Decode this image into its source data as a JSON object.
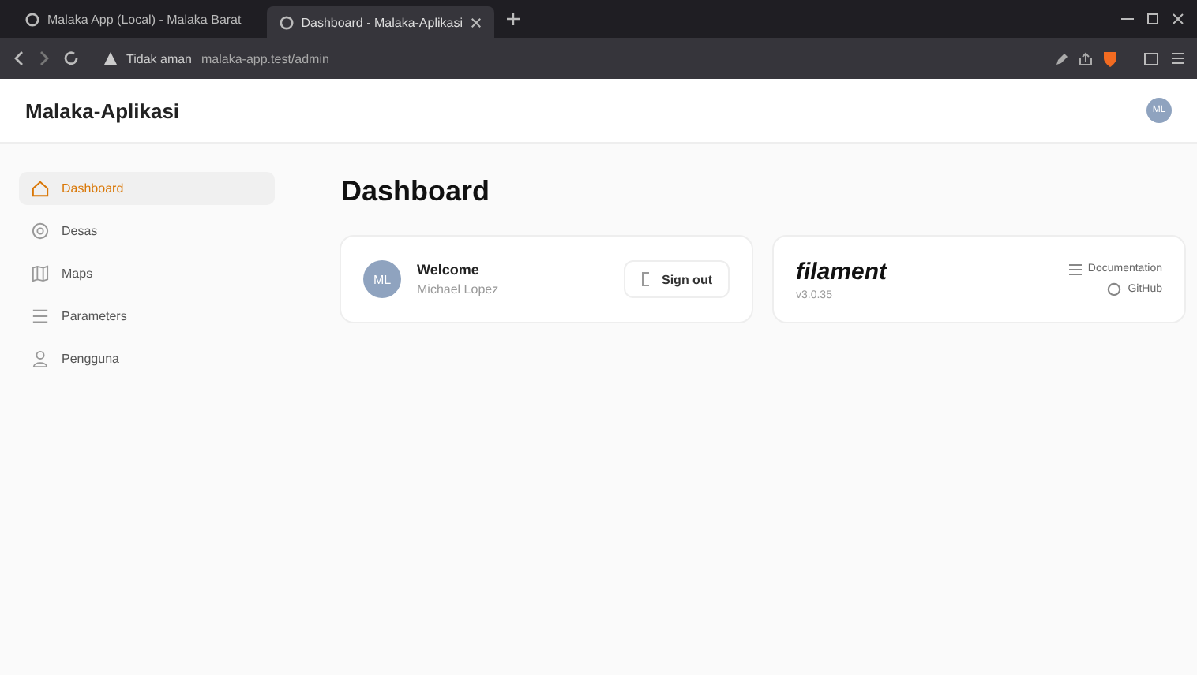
{
  "browser": {
    "tabs": [
      {
        "title": "Malaka App (Local) - Malaka Barat",
        "selected": false
      },
      {
        "title": "Dashboard - Malaka-Aplikasi",
        "selected": true
      }
    ],
    "security_label": "Tidak aman",
    "url": "malaka-app.test/admin"
  },
  "app": {
    "brand": "Malaka-Aplikasi",
    "user_initials": "ML"
  },
  "sidebar": {
    "items": [
      {
        "label": "Dashboard",
        "selected": true
      },
      {
        "label": "Desas",
        "selected": false
      },
      {
        "label": "Maps",
        "selected": false
      },
      {
        "label": "Parameters",
        "selected": false
      },
      {
        "label": "Pengguna",
        "selected": false
      }
    ]
  },
  "page": {
    "title": "Dashboard"
  },
  "account_widget": {
    "initials": "ML",
    "greeting": "Welcome",
    "name": "Michael Lopez",
    "sign_out": "Sign out"
  },
  "filament_widget": {
    "logo": "filament",
    "version": "v3.0.35",
    "links": [
      "Documentation",
      "GitHub"
    ]
  }
}
